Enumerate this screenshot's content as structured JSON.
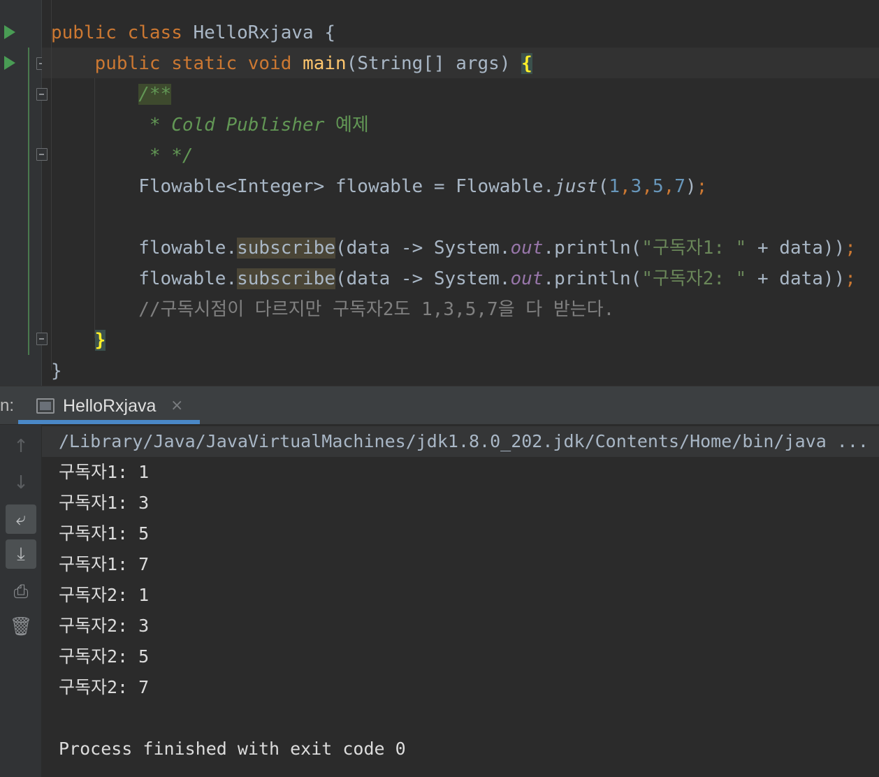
{
  "editor": {
    "lines": [
      [
        {
          "t": "public ",
          "c": "kw"
        },
        {
          "t": "class ",
          "c": "kw"
        },
        {
          "t": "HelloRxjava {"
        }
      ],
      [
        {
          "t": "    "
        },
        {
          "t": "public ",
          "c": "kw"
        },
        {
          "t": "static ",
          "c": "kw"
        },
        {
          "t": "void ",
          "c": "kw"
        },
        {
          "t": "main",
          "c": "fn"
        },
        {
          "t": "(String[] args) "
        },
        {
          "t": "{",
          "c": "brace-hl"
        }
      ],
      [
        {
          "t": "        "
        },
        {
          "t": "/**",
          "c": "doc hl-doc"
        }
      ],
      [
        {
          "t": "         "
        },
        {
          "t": "* Cold Publisher ",
          "c": "doc"
        },
        {
          "t": "예제",
          "c": "docp"
        }
      ],
      [
        {
          "t": "         "
        },
        {
          "t": "* */",
          "c": "doc"
        }
      ],
      [
        {
          "t": "        Flowable<Integer> flowable = Flowable."
        },
        {
          "t": "just",
          "c": "it"
        },
        {
          "t": "("
        },
        {
          "t": "1",
          "c": "num"
        },
        {
          "t": ",",
          "c": "kw"
        },
        {
          "t": "3",
          "c": "num"
        },
        {
          "t": ",",
          "c": "kw"
        },
        {
          "t": "5",
          "c": "num"
        },
        {
          "t": ",",
          "c": "kw"
        },
        {
          "t": "7",
          "c": "num"
        },
        {
          "t": ")"
        },
        {
          "t": ";",
          "c": "kw"
        }
      ],
      [],
      [
        {
          "t": "        flowable."
        },
        {
          "t": "subscribe",
          "c": "hl-sub"
        },
        {
          "t": "(data -> System."
        },
        {
          "t": "out",
          "c": "stat"
        },
        {
          "t": ".println("
        },
        {
          "t": "\"구독자1: \"",
          "c": "str"
        },
        {
          "t": " + data))"
        },
        {
          "t": ";",
          "c": "kw"
        }
      ],
      [
        {
          "t": "        flowable."
        },
        {
          "t": "subscribe",
          "c": "hl-sub"
        },
        {
          "t": "(data -> System."
        },
        {
          "t": "out",
          "c": "stat"
        },
        {
          "t": ".println("
        },
        {
          "t": "\"구독자2: \"",
          "c": "str"
        },
        {
          "t": " + data))"
        },
        {
          "t": ";",
          "c": "kw"
        }
      ],
      [
        {
          "t": "        "
        },
        {
          "t": "//구독시점이 다르지만 구독자2도 1,3,5,7을 다 받는다.",
          "c": "cmt"
        }
      ],
      [
        {
          "t": "    "
        },
        {
          "t": "}",
          "c": "brace-hl"
        }
      ],
      [
        {
          "t": "}"
        }
      ]
    ]
  },
  "run_panel": {
    "label": "n:",
    "tab_title": "HelloRxjava",
    "tab_close": "×",
    "toolbar": {
      "up_icon": "↑",
      "down_icon": "↓",
      "wrap_icon": "⤶",
      "scroll_end_icon": "⤓",
      "print_icon": "⎙",
      "trash_icon": "🗑"
    },
    "console": {
      "command": "/Library/Java/JavaVirtualMachines/jdk1.8.0_202.jdk/Contents/Home/bin/java ...",
      "output": [
        "구독자1: 1",
        "구독자1: 3",
        "구독자1: 5",
        "구독자1: 7",
        "구독자2: 1",
        "구독자2: 3",
        "구독자2: 5",
        "구독자2: 7",
        "",
        "Process finished with exit code 0"
      ]
    }
  }
}
